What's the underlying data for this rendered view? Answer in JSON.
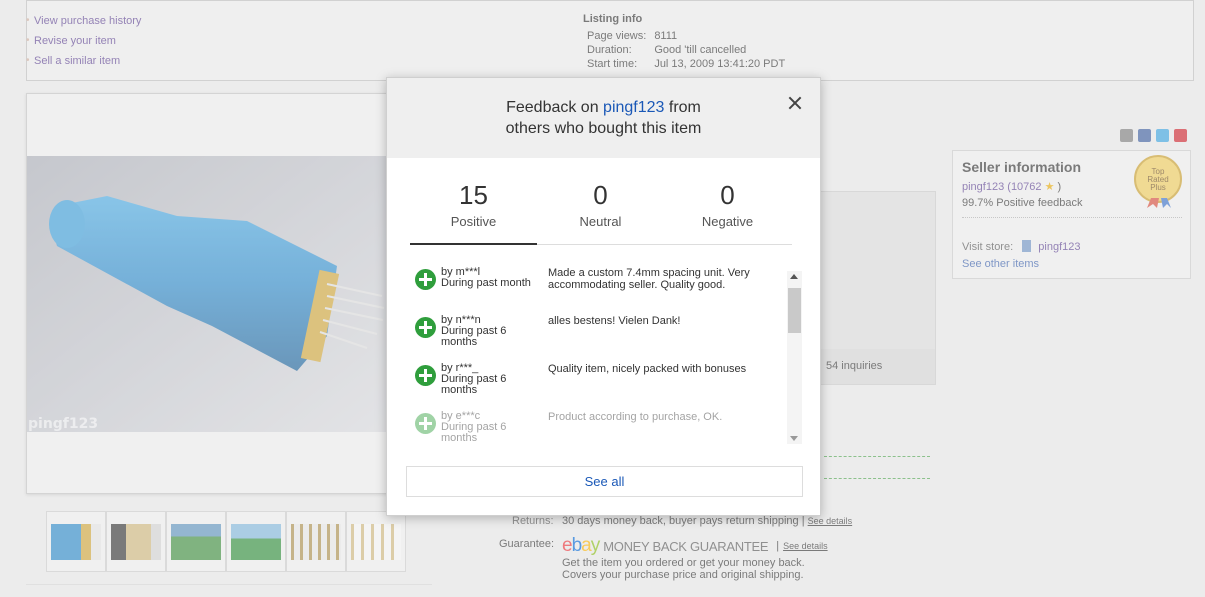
{
  "top_links": [
    "View purchase history",
    "Revise your item",
    "Sell a similar item"
  ],
  "listing_info": {
    "title": "Listing info",
    "rows": [
      {
        "label": "Page views:",
        "value": "8111"
      },
      {
        "label": "Duration:",
        "value": "Good 'till cancelled"
      },
      {
        "label": "Start time:",
        "value": "Jul 13, 2009 13:41:20 PDT"
      }
    ]
  },
  "product": {
    "watermark": "pingf123"
  },
  "inquiries": "54 inquiries",
  "seller": {
    "title": "Seller information",
    "name": "pingf123",
    "score": "(10762",
    "score_close": ")",
    "positive": "99.7% Positive feedback",
    "visit_store_label": "Visit store:",
    "store_name": "pingf123",
    "other_items": "See other items",
    "badge_text": "Top Rated Plus"
  },
  "returns": {
    "label": "Returns:",
    "value": "30 days money back, buyer pays return shipping",
    "sep": "|",
    "link": "See details"
  },
  "guarantee": {
    "label": "Guarantee:",
    "logo": [
      "e",
      "b",
      "a",
      "y"
    ],
    "mbg": "MONEY BACK GUARANTEE",
    "sep": "|",
    "link": "See details",
    "desc1": "Get the item you ordered or get your money back.",
    "desc2": "Covers your purchase price and original shipping."
  },
  "modal": {
    "title_pre": "Feedback on ",
    "seller_link": "pingf123",
    "title_post": " from",
    "title_line2": "others who bought this item",
    "counts": [
      {
        "num": "15",
        "label": "Positive"
      },
      {
        "num": "0",
        "label": "Neutral"
      },
      {
        "num": "0",
        "label": "Negative"
      }
    ],
    "feedback": [
      {
        "by": "by m***l",
        "when": "During past month",
        "text": "Made a custom 7.4mm spacing unit. Very accommodating seller. Quality good."
      },
      {
        "by": "by n***n",
        "when": "During past 6 months",
        "text": "alles bestens! Vielen Dank!"
      },
      {
        "by": "by r***_",
        "when": "During past 6 months",
        "text": "Quality item, nicely packed with bonuses"
      },
      {
        "by": "by e***c",
        "when": "During past 6 months",
        "text": "Product according to purchase, OK."
      }
    ],
    "see_all": "See all"
  },
  "colors": {
    "link_blue": "#1a58b7",
    "positive_green": "#2f9e3c",
    "link_purple": "#5a3f8e"
  }
}
